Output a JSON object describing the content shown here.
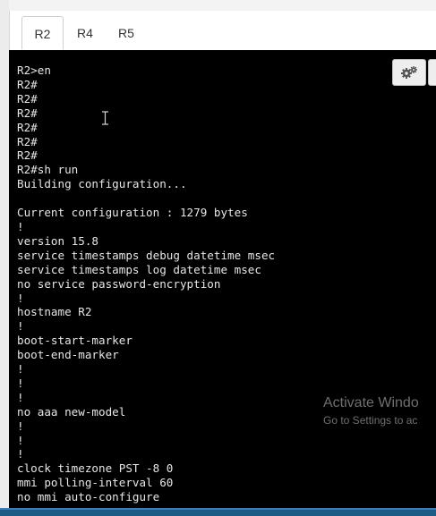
{
  "tabs": [
    {
      "label": "R2",
      "active": true
    },
    {
      "label": "R4",
      "active": false
    },
    {
      "label": "R5",
      "active": false
    }
  ],
  "terminal": {
    "lines": [
      "R2>en",
      "R2#",
      "R2#",
      "R2#",
      "R2#",
      "R2#",
      "R2#",
      "R2#sh run",
      "Building configuration...",
      "",
      "Current configuration : 1279 bytes",
      "!",
      "version 15.8",
      "service timestamps debug datetime msec",
      "service timestamps log datetime msec",
      "no service password-encryption",
      "!",
      "hostname R2",
      "!",
      "boot-start-marker",
      "boot-end-marker",
      "!",
      "!",
      "!",
      "no aaa new-model",
      "!",
      "!",
      "!",
      "clock timezone PST -8 0",
      "mmi polling-interval 60",
      "no mmi auto-configure"
    ],
    "settings_icon": "gears-icon",
    "text_color": "#e6e6e6",
    "background": "#000000"
  },
  "watermark": {
    "title": "Activate Windo",
    "subtitle": "Go to Settings to ac"
  },
  "colors": {
    "taskbar": "#1e5a86"
  }
}
